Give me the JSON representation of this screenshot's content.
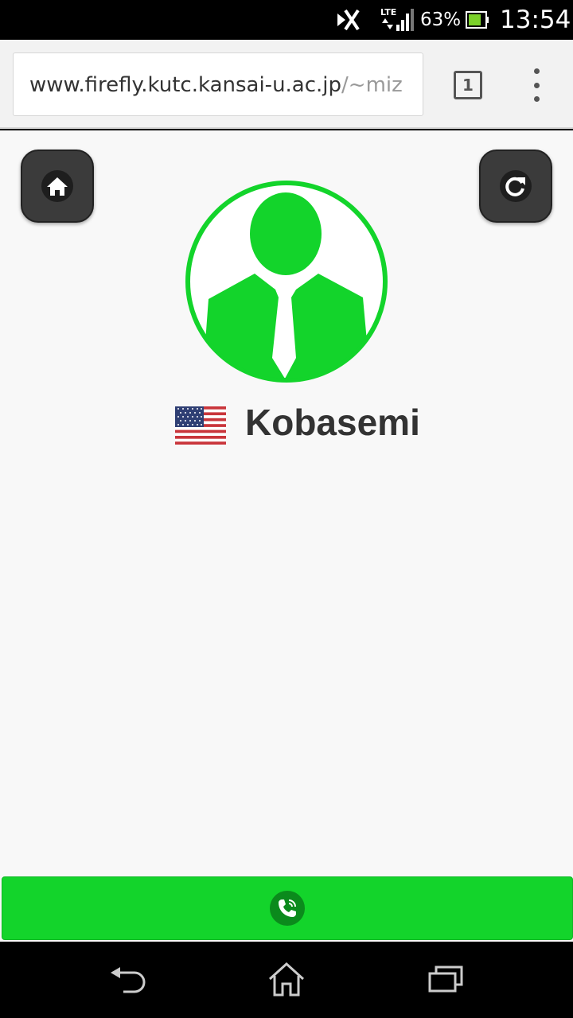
{
  "status_bar": {
    "network": "LTE",
    "battery_percent": "63%",
    "battery_level": 0.63,
    "time": "13:54",
    "icons": [
      "signal-off-icon",
      "lte-signal-icon",
      "battery-icon"
    ]
  },
  "browser": {
    "url_host": "www.firefly.kutc.kansai-u.ac.jp",
    "url_path": "/~miz",
    "tab_count": "1",
    "icons": [
      "tabs-icon",
      "overflow-menu-icon"
    ]
  },
  "page": {
    "contact_name": "Kobasemi",
    "country_flag": "us-flag-icon",
    "avatar": "person-avatar-icon",
    "buttons": [
      "home-icon",
      "reload-icon",
      "phone-icon"
    ],
    "colors": {
      "accent_green": "#13d42b",
      "button_dark": "#3b3b3b",
      "background": "#f8f8f8",
      "text": "#333333"
    }
  },
  "nav_bar": {
    "icons": [
      "back-icon",
      "home-nav-icon",
      "recents-icon"
    ]
  }
}
